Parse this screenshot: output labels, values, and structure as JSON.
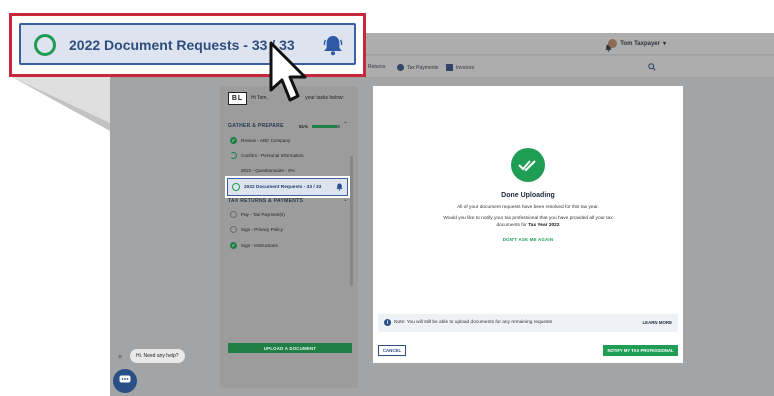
{
  "topbar": {
    "user_name": "Tom Taxpayer",
    "user_caret": "▾"
  },
  "navbar": {
    "items": [
      {
        "label": "Returns"
      },
      {
        "label": "Tax Payments"
      },
      {
        "label": "Invoices"
      }
    ]
  },
  "sidebar": {
    "logo": "BL",
    "greeting": "Hi Tom,",
    "greeting_suffix": "your tasks below:",
    "sections": [
      {
        "title": "GATHER & PREPARE",
        "progress": "91%",
        "progress_value": 0.91
      },
      {
        "title": "TAX RETURNS & PAYMENTS"
      }
    ],
    "tasks_gather": [
      {
        "label": "Review - ABC Company",
        "state": "done"
      },
      {
        "label": "Confirm - Personal Information",
        "state": "partial"
      },
      {
        "label": "2022 - Questionnaire - 0%",
        "state": "empty"
      }
    ],
    "highlighted_task": {
      "label": "2022 Document Requests - 33 / 33"
    },
    "tasks_returns": [
      {
        "label": "Pay - Tax Payment(s)",
        "state": "empty"
      },
      {
        "label": "Sign - Privacy Policy",
        "state": "empty"
      },
      {
        "label": "Sign - Instructions",
        "state": "done"
      }
    ],
    "upload_button": "UPLOAD A DOCUMENT"
  },
  "modal": {
    "title": "Done Uploading",
    "line1": "All of your document requests have been resolved for this tax year.",
    "line2": "Would you like to notify your tax professional that you have provided all your tax",
    "line3_prefix": "documents for",
    "line3_bold": "Tax Year 2022",
    "dont_ask": "DON'T ASK ME AGAIN",
    "note_text": "Note: You will still be able to upload documents for any remaining requests",
    "learn_more": "LEARN MORE",
    "cancel": "CANCEL",
    "notify": "NOTIFY MY TAX PROFESSIONAL"
  },
  "chat": {
    "close": "×",
    "bubble": "Hi. Need any help?"
  },
  "callout": {
    "label": "2022 Document Requests - 33 / 33"
  },
  "colors": {
    "accent_green": "#1f9d55",
    "brand_blue": "#2a4f86",
    "callout_border": "#c8283a"
  }
}
